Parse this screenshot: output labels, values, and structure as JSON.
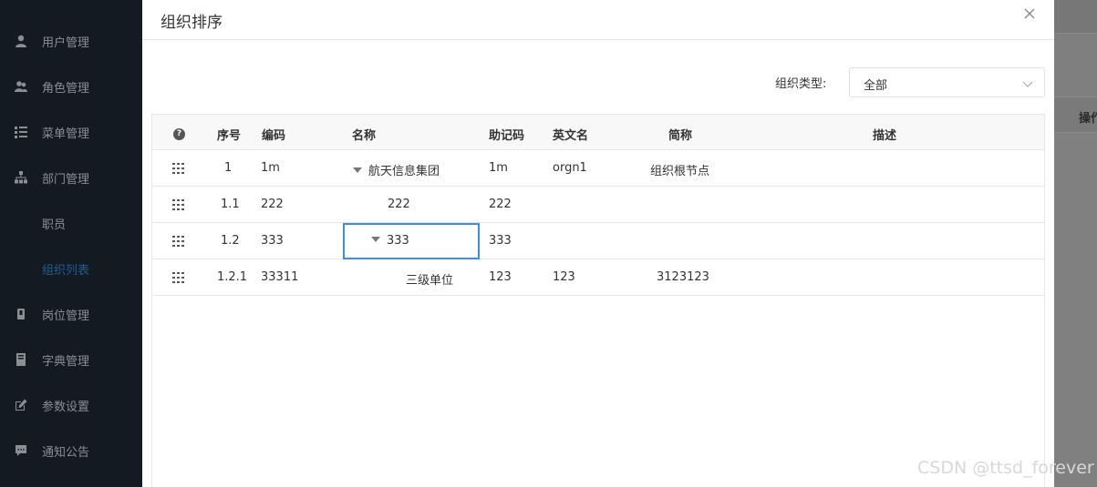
{
  "sidebar": {
    "items": [
      {
        "label": "用户管理",
        "icon": "user-icon"
      },
      {
        "label": "角色管理",
        "icon": "users-icon"
      },
      {
        "label": "菜单管理",
        "icon": "menu-list-icon"
      },
      {
        "label": "部门管理",
        "icon": "sitemap-icon"
      },
      {
        "label": "职员",
        "icon": ""
      },
      {
        "label": "组织列表",
        "icon": "",
        "active": true
      },
      {
        "label": "岗位管理",
        "icon": "badge-icon"
      },
      {
        "label": "字典管理",
        "icon": "book-icon"
      },
      {
        "label": "参数设置",
        "icon": "edit-icon"
      },
      {
        "label": "通知公告",
        "icon": "comment-icon"
      }
    ],
    "active_color": "#1e5e96"
  },
  "background_page": {
    "column_header": "操作"
  },
  "modal": {
    "title": "组织排序",
    "filter": {
      "label": "组织类型:",
      "value": "全部"
    },
    "table": {
      "headers": {
        "help": "?",
        "seq": "序号",
        "code": "编码",
        "name": "名称",
        "mnemonic": "助记码",
        "english": "英文名",
        "short": "简称",
        "desc": "描述"
      },
      "rows": [
        {
          "seq": "1",
          "code": "1m",
          "name": "航天信息集团",
          "mnemonic": "1m",
          "english": "orgn1",
          "short": "组织根节点",
          "desc": "",
          "expanded": true
        },
        {
          "seq": "1.1",
          "code": "222",
          "name": "222",
          "mnemonic": "222",
          "english": "",
          "short": "",
          "desc": ""
        },
        {
          "seq": "1.2",
          "code": "333",
          "name": "333",
          "mnemonic": "333",
          "english": "",
          "short": "",
          "desc": "",
          "expanded": true,
          "editing": true
        },
        {
          "seq": "1.2.1",
          "code": "33311",
          "name": "三级单位",
          "mnemonic": "123",
          "english": "123",
          "short": "3123123",
          "desc": ""
        }
      ]
    }
  },
  "watermark": "CSDN @ttsd_forever",
  "colors": {
    "sidebar_bg": "#141a22",
    "accent": "#3a8ee6"
  }
}
